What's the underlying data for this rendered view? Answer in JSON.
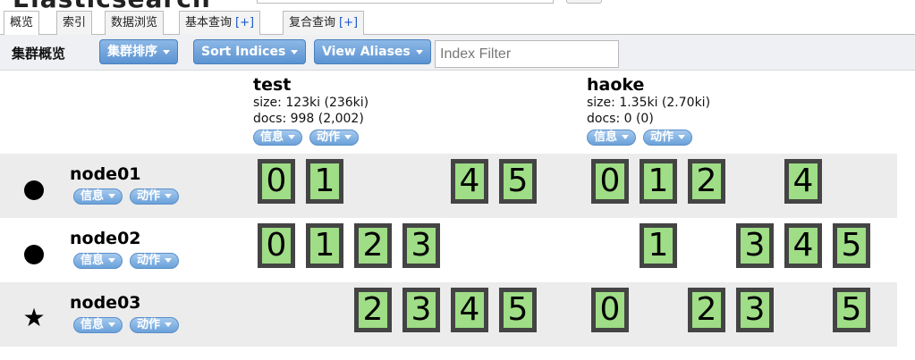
{
  "app": {
    "title": "Elasticsearch"
  },
  "tabs": [
    {
      "label": "概览",
      "plus": ""
    },
    {
      "label": "索引",
      "plus": ""
    },
    {
      "label": "数据浏览",
      "plus": ""
    },
    {
      "label": "基本查询",
      "plus": "[+]"
    },
    {
      "label": "复合查询",
      "plus": "[+]"
    }
  ],
  "toolbar": {
    "title": "集群概览",
    "cluster_sort": "集群排序",
    "sort_indices": "Sort Indices",
    "view_aliases": "View Aliases",
    "filter_placeholder": "Index Filter"
  },
  "actions": {
    "info": "信息",
    "action": "动作"
  },
  "indices": [
    {
      "name": "test",
      "size": "size: 123ki (236ki)",
      "docs": "docs: 998 (2,002)"
    },
    {
      "name": "haoke",
      "size": "size: 1.35ki (2.70ki)",
      "docs": "docs: 0 (0)"
    }
  ],
  "nodes": [
    {
      "name": "node01",
      "icon": "circle",
      "test_shards": [
        "0",
        "1",
        "",
        "",
        "4",
        "5"
      ],
      "haoke_shards": [
        "0",
        "1",
        "2",
        "",
        "4",
        ""
      ]
    },
    {
      "name": "node02",
      "icon": "circle",
      "test_shards": [
        "0",
        "1",
        "2",
        "3",
        "",
        ""
      ],
      "haoke_shards": [
        "",
        "1",
        "",
        "3",
        "4",
        "5"
      ]
    },
    {
      "name": "node03",
      "icon": "star",
      "test_shards": [
        "",
        "",
        "2",
        "3",
        "4",
        "5"
      ],
      "haoke_shards": [
        "0",
        "",
        "2",
        "3",
        "",
        "5"
      ]
    }
  ],
  "colors": {
    "shard_fill": "#9fdd86",
    "shard_border": "#444444",
    "button_blue": "#5b93d2"
  }
}
